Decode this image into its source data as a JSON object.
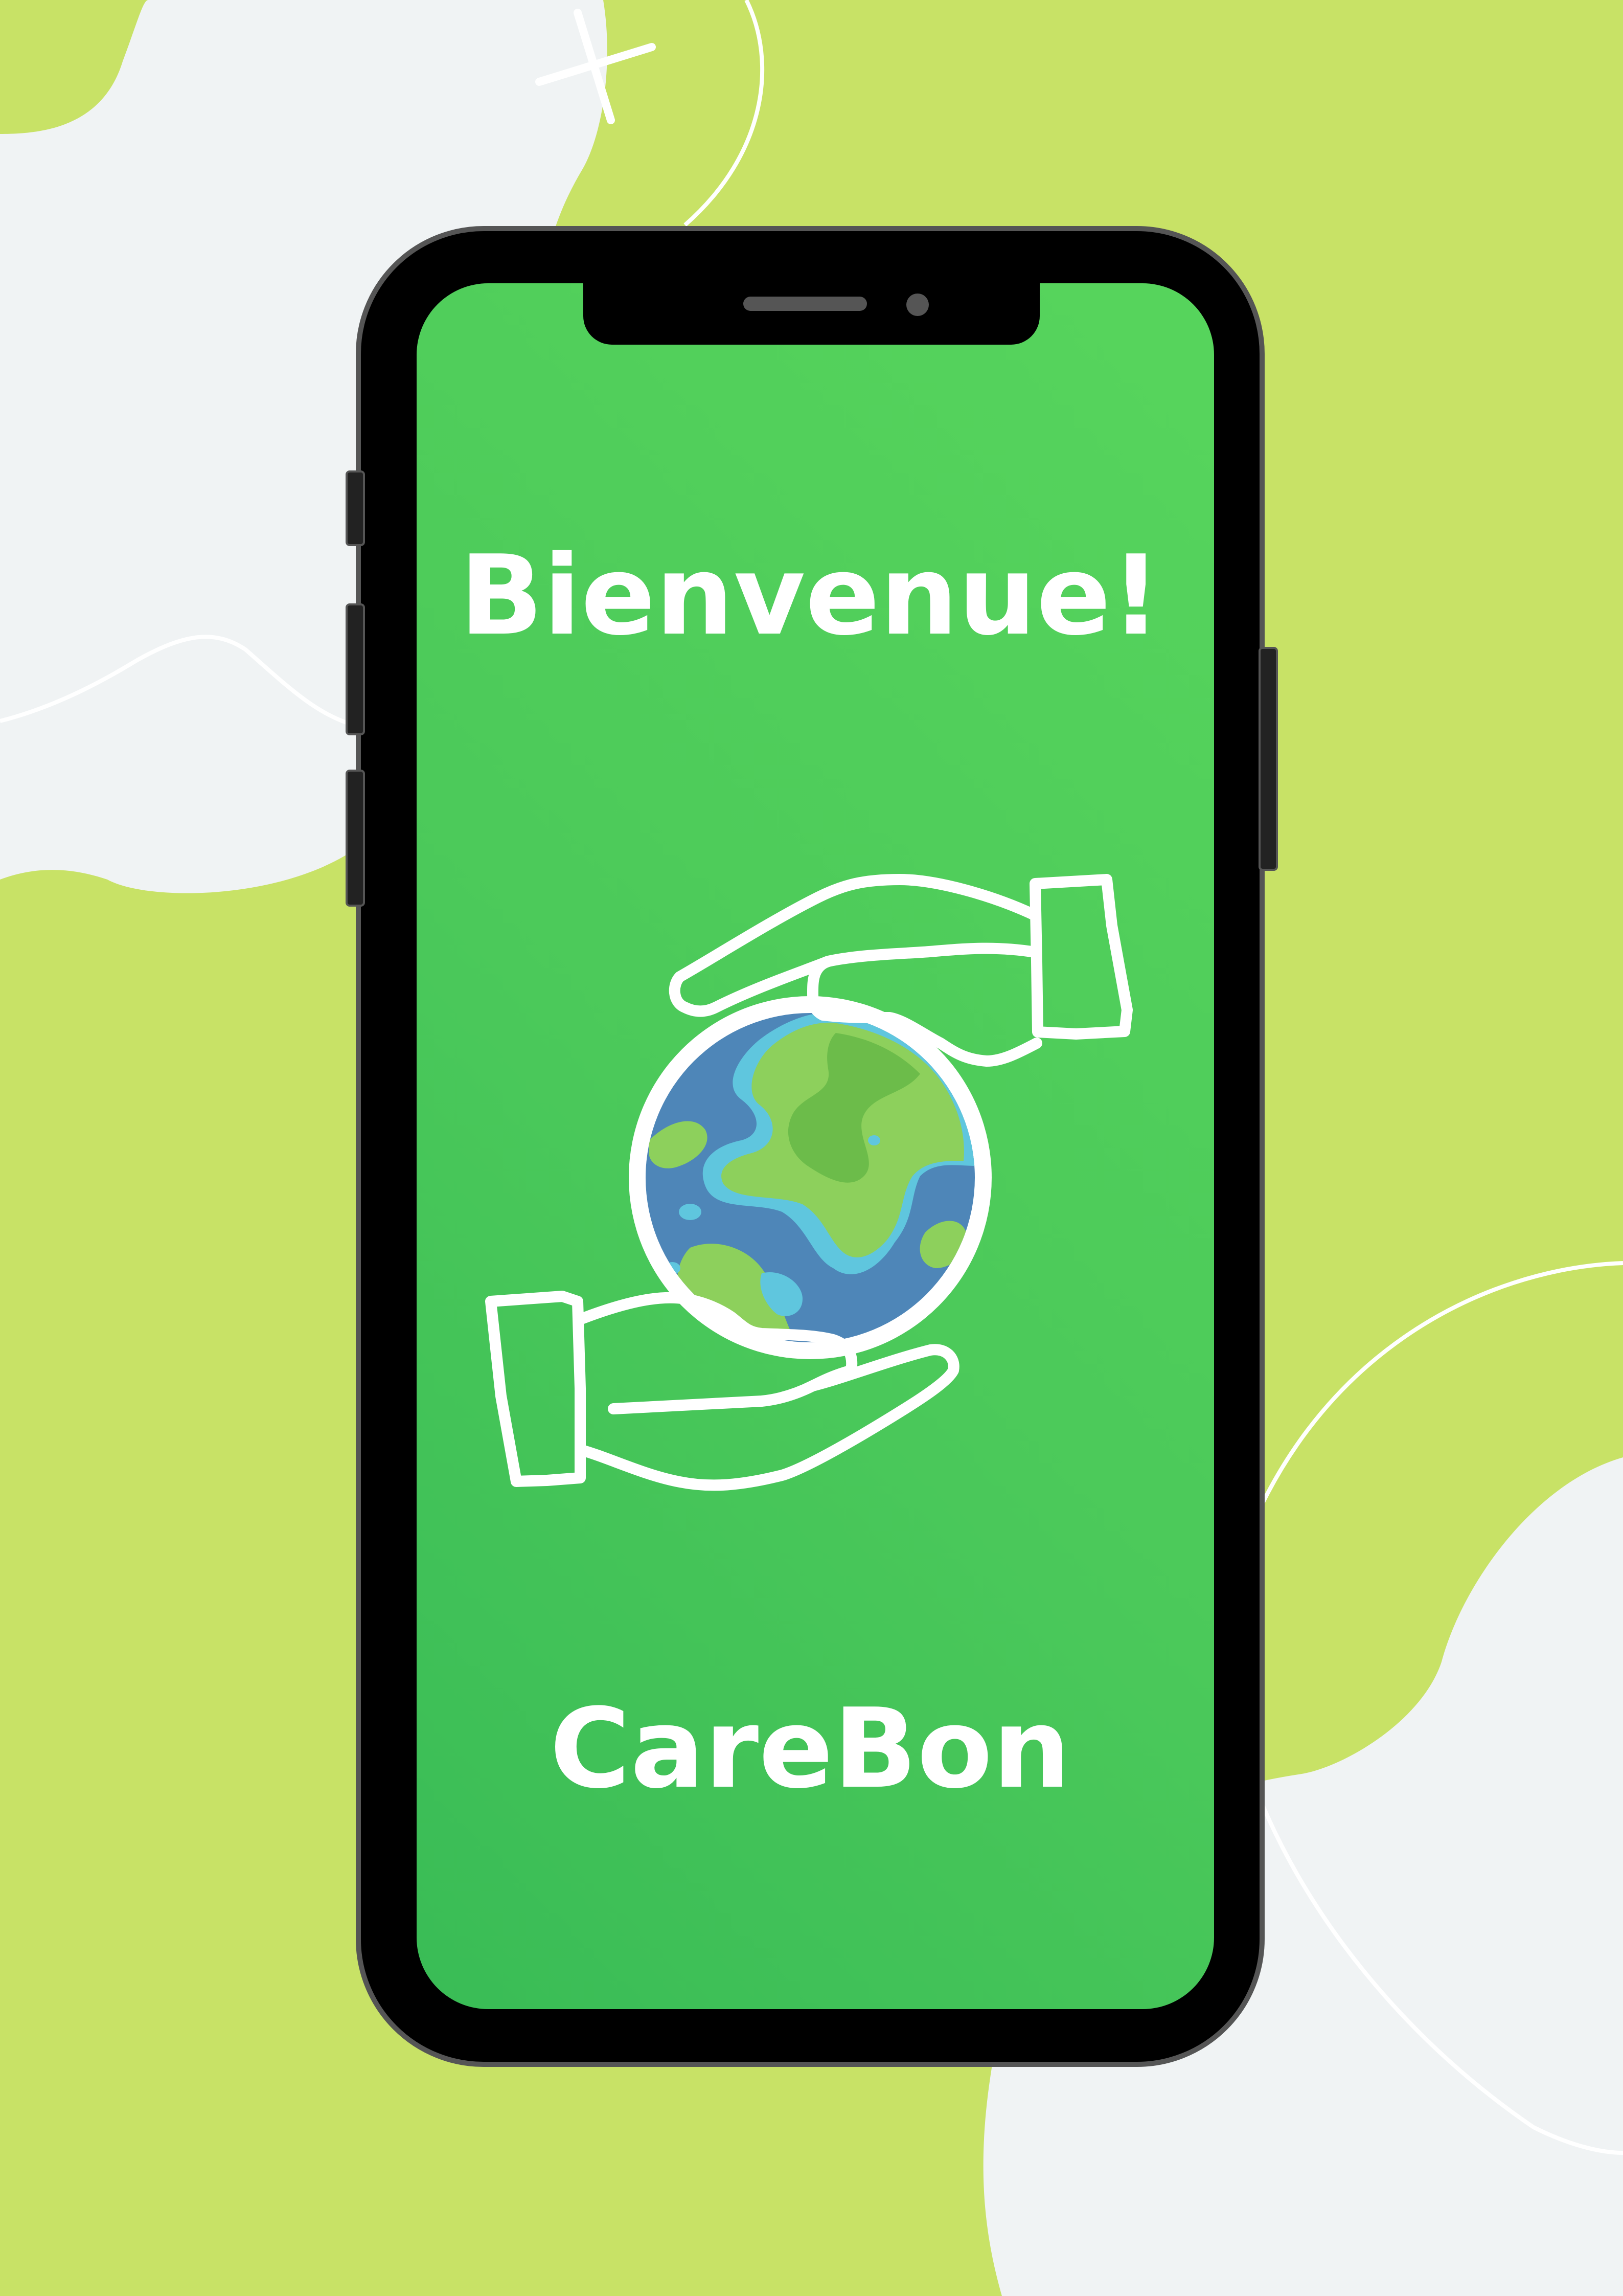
{
  "screen": {
    "title": "Bienvenue!",
    "brand": "CareBon"
  },
  "logo": {
    "icon": "hands-holding-earth-icon"
  },
  "colors": {
    "background": "#c8e266",
    "blob": "#f0f3f4",
    "screen_green": "#4bc95a",
    "phone_frame": "#000000",
    "ocean": "#4e86b8",
    "land": "#8dd05c",
    "coast": "#5fc6de"
  }
}
